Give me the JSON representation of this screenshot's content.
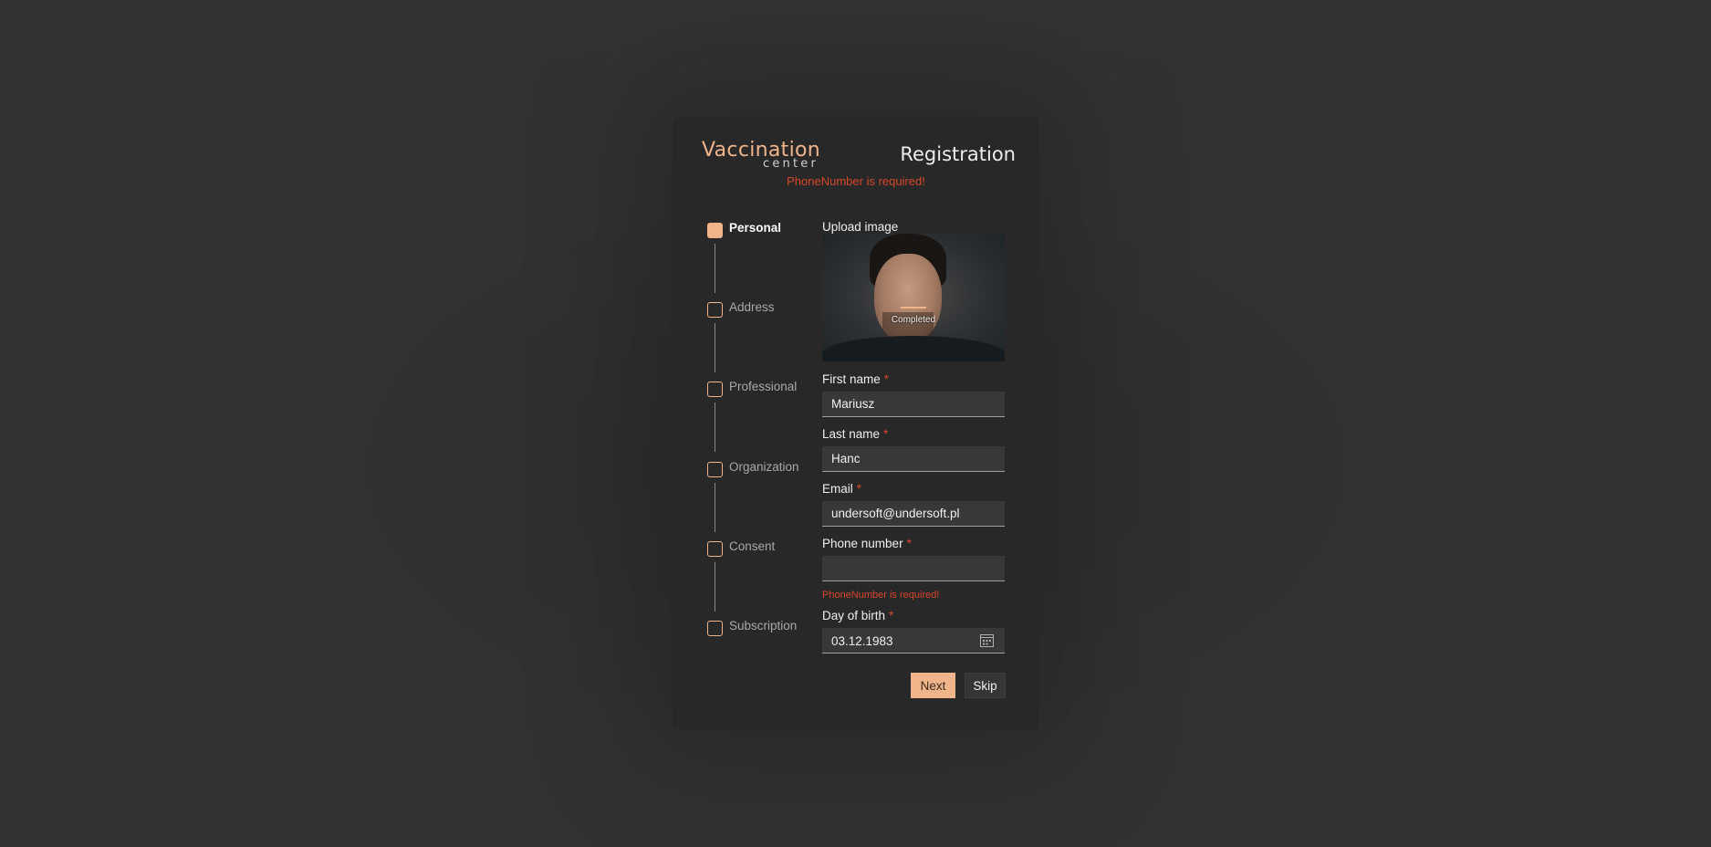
{
  "logo": {
    "line1": "Vaccination",
    "line2": "center"
  },
  "page_title": "Registration",
  "form_error": "PhoneNumber is required!",
  "steps": [
    {
      "label": "Personal",
      "active": true
    },
    {
      "label": "Address",
      "active": false
    },
    {
      "label": "Professional",
      "active": false
    },
    {
      "label": "Organization",
      "active": false
    },
    {
      "label": "Consent",
      "active": false
    },
    {
      "label": "Subscription",
      "active": false
    }
  ],
  "upload": {
    "label": "Upload image",
    "status": "Completed"
  },
  "fields": {
    "first_name": {
      "label": "First name",
      "required_mark": "*",
      "value": "Mariusz"
    },
    "last_name": {
      "label": "Last name",
      "required_mark": "*",
      "value": "Hanc"
    },
    "email": {
      "label": "Email",
      "required_mark": "*",
      "value": "undersoft@undersoft.pl"
    },
    "phone": {
      "label": "Phone number",
      "required_mark": "*",
      "value": "",
      "error": "PhoneNumber is required!"
    },
    "birth": {
      "label": "Day of birth",
      "required_mark": "*",
      "value": "03.12.1983",
      "icon": "calendar-icon"
    }
  },
  "buttons": {
    "next": "Next",
    "skip": "Skip"
  },
  "colors": {
    "accent": "#f0b48a",
    "error": "#d6472a",
    "card": "#282828",
    "page": "#333333"
  }
}
